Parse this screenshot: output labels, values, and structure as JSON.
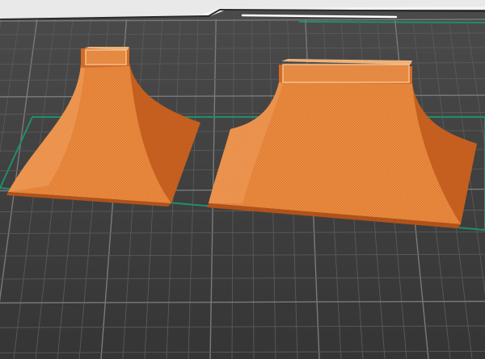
{
  "app": {
    "view": "3d-build-plate-preview"
  },
  "scene": {
    "plate_color": "#3b3b3b",
    "plate_top_band_color": "#e9e9e9",
    "grid_fine_color": "#5a5a5a",
    "grid_major_color": "#7a7a7a",
    "selection_outline_color": "#1f8f6a",
    "model_color": "#e0792c",
    "model_shadow_color": "#b9561a",
    "model_highlight_color": "#f2a35e",
    "objects": [
      {
        "name": "object-small-funnel",
        "selected": true
      },
      {
        "name": "object-large-funnel",
        "selected": true
      }
    ]
  }
}
